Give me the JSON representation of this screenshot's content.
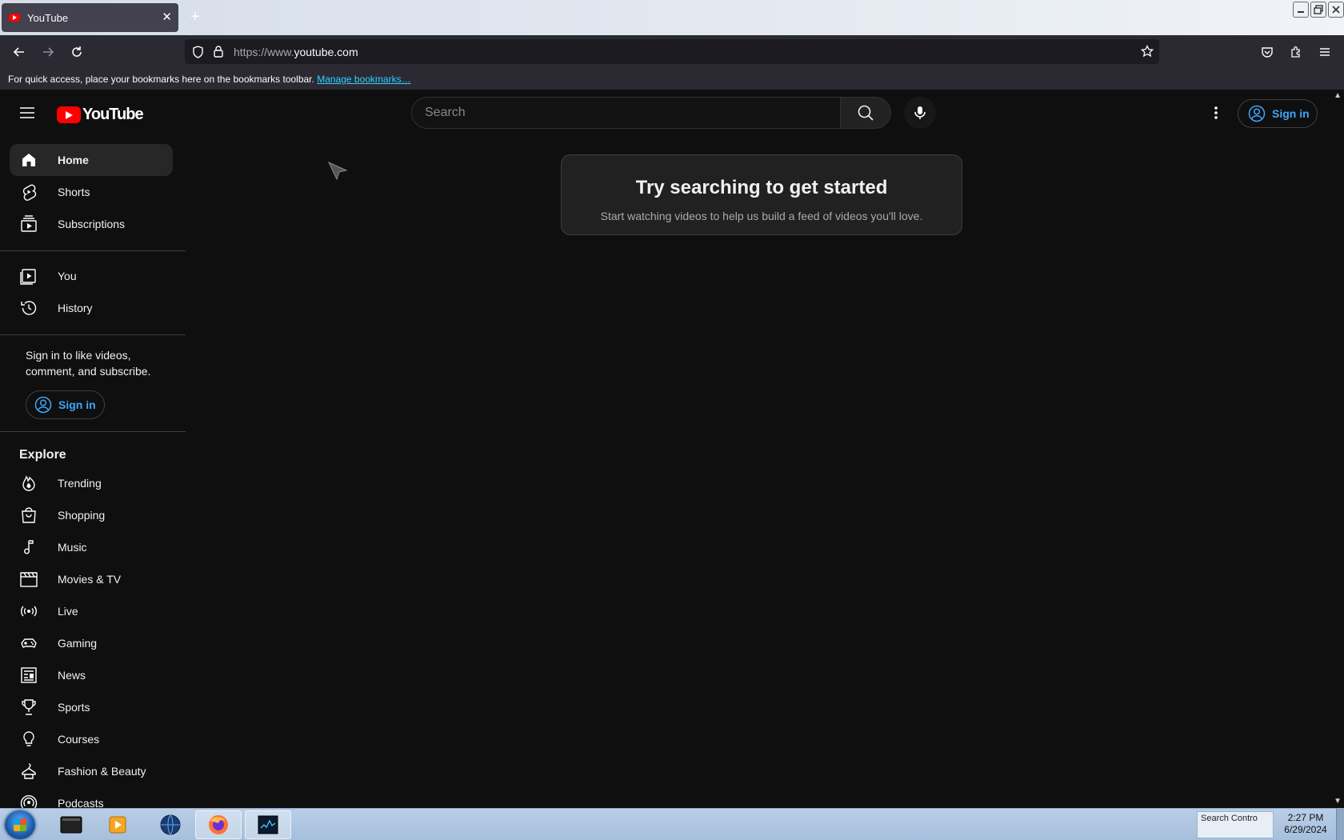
{
  "browser": {
    "tab_title": "YouTube",
    "tab_close": "✕",
    "new_tab": "+",
    "url_prefix": "https://www.",
    "url_domain": "youtube.com",
    "bookmarks_text": "For quick access, place your bookmarks here on the bookmarks toolbar.",
    "bookmarks_link": "Manage bookmarks…"
  },
  "header": {
    "logo_text": "YouTube",
    "search_placeholder": "Search",
    "sign_in": "Sign in"
  },
  "sidebar": {
    "primary": [
      {
        "label": "Home",
        "icon": "home-icon",
        "active": true
      },
      {
        "label": "Shorts",
        "icon": "shorts-icon"
      },
      {
        "label": "Subscriptions",
        "icon": "subscriptions-icon"
      }
    ],
    "secondary": [
      {
        "label": "You",
        "icon": "you-icon"
      },
      {
        "label": "History",
        "icon": "history-icon"
      }
    ],
    "signin_prompt": "Sign in to like videos, comment, and subscribe.",
    "signin_button": "Sign in",
    "explore_heading": "Explore",
    "explore": [
      {
        "label": "Trending",
        "icon": "trending-icon"
      },
      {
        "label": "Shopping",
        "icon": "shopping-icon"
      },
      {
        "label": "Music",
        "icon": "music-icon"
      },
      {
        "label": "Movies & TV",
        "icon": "movies-icon"
      },
      {
        "label": "Live",
        "icon": "live-icon"
      },
      {
        "label": "Gaming",
        "icon": "gaming-icon"
      },
      {
        "label": "News",
        "icon": "news-icon"
      },
      {
        "label": "Sports",
        "icon": "sports-icon"
      },
      {
        "label": "Courses",
        "icon": "courses-icon"
      },
      {
        "label": "Fashion & Beauty",
        "icon": "fashion-icon"
      },
      {
        "label": "Podcasts",
        "icon": "podcasts-icon"
      }
    ]
  },
  "main": {
    "prompt_title": "Try searching to get started",
    "prompt_subtitle": "Start watching videos to help us build a feed of videos you'll love."
  },
  "taskbar": {
    "tray_text": "Search Contro",
    "time": "2:27 PM",
    "date": "6/29/2024"
  },
  "colors": {
    "background": "#0f0f0f",
    "accent_blue": "#3ea6ff",
    "youtube_red": "#ff0000"
  }
}
